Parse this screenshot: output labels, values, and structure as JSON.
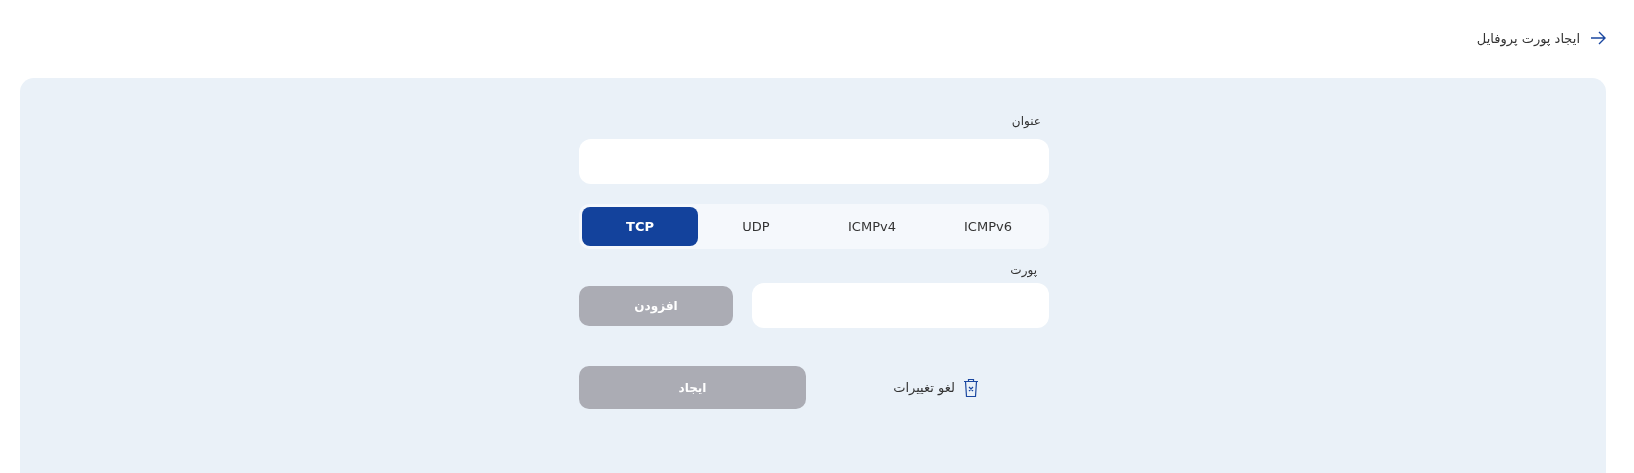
{
  "header": {
    "title": "ایجاد پورت پروفایل"
  },
  "form": {
    "title_label": "عنوان",
    "protocols": [
      {
        "label": "ICMPv6",
        "selected": false
      },
      {
        "label": "ICMPv4",
        "selected": false
      },
      {
        "label": "UDP",
        "selected": false
      },
      {
        "label": "TCP",
        "selected": true
      }
    ],
    "port_label": "پورت",
    "add_button": {
      "label": "افزودن",
      "disabled": true
    },
    "cancel_link": {
      "label": "لغو تغییرات"
    },
    "create_button": {
      "label": "ایجاد",
      "disabled": true
    }
  }
}
